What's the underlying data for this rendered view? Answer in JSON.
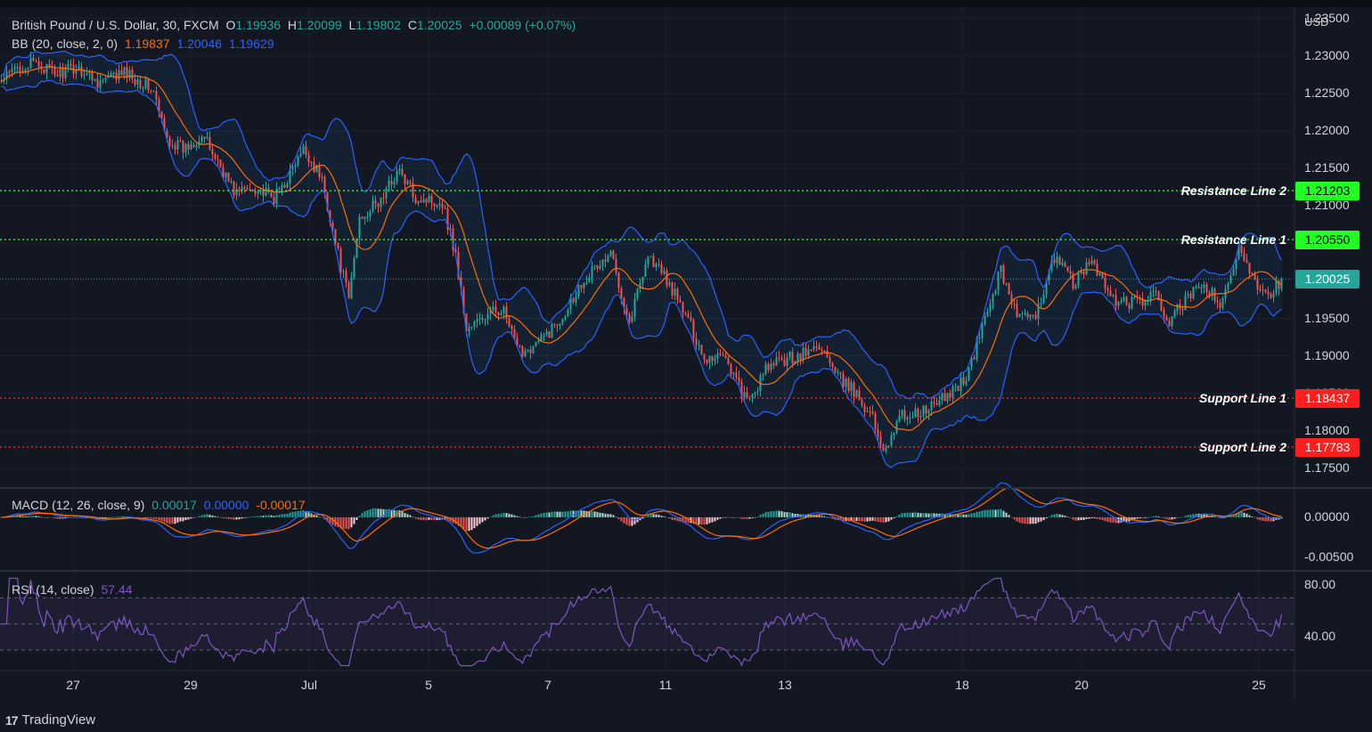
{
  "header": {
    "symbol": "British Pound / U.S. Dollar, 30, FXCM",
    "open_label": "O",
    "open": "1.19936",
    "high_label": "H",
    "high": "1.20099",
    "low_label": "L",
    "low": "1.19802",
    "close_label": "C",
    "close": "1.20025",
    "change": "+0.00089 (+0.07%)"
  },
  "bb": {
    "label": "BB (20, close, 2, 0)",
    "basis": "1.19837",
    "upper": "1.20046",
    "lower": "1.19629"
  },
  "macd": {
    "label": "MACD (12, 26, close, 9)",
    "hist": "0.00017",
    "macd": "0.00000",
    "signal": "-0.00017"
  },
  "rsi": {
    "label": "RSI (14, close)",
    "value": "57.44"
  },
  "axis": {
    "unit": "USD",
    "price_ticks": [
      "1.23500",
      "1.23000",
      "1.22500",
      "1.22000",
      "1.21500",
      "1.21000",
      "1.20500",
      "1.19500",
      "1.19000",
      "1.18500",
      "1.18000",
      "1.17500"
    ],
    "macd_ticks": [
      "0.00000",
      "-0.00500"
    ],
    "rsi_ticks": [
      "80.00",
      "40.00"
    ],
    "x_ticks": [
      "27",
      "29",
      "Jul",
      "5",
      "7",
      "11",
      "13",
      "18",
      "20",
      "25"
    ]
  },
  "lines": [
    {
      "name": "Resistance Line 2",
      "value": "1.21203",
      "color": "#22ff22",
      "badge_text_color": "#000000"
    },
    {
      "name": "Resistance Line 1",
      "value": "1.20550",
      "color": "#22ff22",
      "badge_text_color": "#000000"
    },
    {
      "name": "Support Line 1",
      "value": "1.18437",
      "color": "#ff1f1f",
      "badge_text_color": "#ffffff"
    },
    {
      "name": "Support Line 2",
      "value": "1.17783",
      "color": "#ff1f1f",
      "badge_text_color": "#ffffff"
    }
  ],
  "last_price": {
    "value": "1.20025",
    "color": "#26a69a"
  },
  "colors": {
    "up": "#26a69a",
    "down": "#ef5350",
    "bb_band": "#2962ff",
    "bb_basis": "#ff6d00",
    "macd_line": "#2962ff",
    "signal_line": "#ff6d00",
    "rsi_line": "#7e57c2"
  },
  "brand": "TradingView",
  "chart_data": {
    "type": "candlestick",
    "title": "British Pound / U.S. Dollar, 30, FXCM",
    "ylim": [
      1.1725,
      1.2365
    ],
    "dates": [
      "27",
      "29",
      "Jul",
      "5",
      "7",
      "11",
      "13",
      "18",
      "20",
      "25"
    ],
    "close_path": [
      [
        0,
        1.2265
      ],
      [
        18,
        1.2285
      ],
      [
        40,
        1.229
      ],
      [
        60,
        1.2275
      ],
      [
        85,
        1.2285
      ],
      [
        110,
        1.2265
      ],
      [
        140,
        1.2278
      ],
      [
        170,
        1.2255
      ],
      [
        185,
        1.219
      ],
      [
        205,
        1.2175
      ],
      [
        225,
        1.2195
      ],
      [
        245,
        1.2155
      ],
      [
        262,
        1.2118
      ],
      [
        285,
        1.2125
      ],
      [
        305,
        1.2108
      ],
      [
        320,
        1.2135
      ],
      [
        340,
        1.2175
      ],
      [
        360,
        1.2135
      ],
      [
        378,
        1.2035
      ],
      [
        390,
        1.1975
      ],
      [
        402,
        1.2085
      ],
      [
        425,
        1.2105
      ],
      [
        445,
        1.2148
      ],
      [
        465,
        1.2112
      ],
      [
        495,
        1.2105
      ],
      [
        510,
        1.2035
      ],
      [
        522,
        1.1935
      ],
      [
        540,
        1.195
      ],
      [
        562,
        1.1965
      ],
      [
        580,
        1.1905
      ],
      [
        600,
        1.1915
      ],
      [
        625,
        1.1945
      ],
      [
        655,
        1.2005
      ],
      [
        685,
        1.2035
      ],
      [
        705,
        1.1945
      ],
      [
        725,
        1.2035
      ],
      [
        745,
        1.2005
      ],
      [
        770,
        1.195
      ],
      [
        790,
        1.1895
      ],
      [
        810,
        1.1905
      ],
      [
        838,
        1.1835
      ],
      [
        860,
        1.1885
      ],
      [
        880,
        1.1895
      ],
      [
        905,
        1.1905
      ],
      [
        920,
        1.1915
      ],
      [
        935,
        1.1875
      ],
      [
        955,
        1.1855
      ],
      [
        975,
        1.1825
      ],
      [
        990,
        1.1775
      ],
      [
        1010,
        1.182
      ],
      [
        1035,
        1.1825
      ],
      [
        1060,
        1.1845
      ],
      [
        1085,
        1.1875
      ],
      [
        1105,
        1.1955
      ],
      [
        1122,
        1.2015
      ],
      [
        1140,
        1.1955
      ],
      [
        1160,
        1.1945
      ],
      [
        1180,
        1.2035
      ],
      [
        1205,
        1.1995
      ],
      [
        1225,
        1.203
      ],
      [
        1245,
        1.1975
      ],
      [
        1270,
        1.197
      ],
      [
        1295,
        1.198
      ],
      [
        1310,
        1.1945
      ],
      [
        1330,
        1.1975
      ],
      [
        1350,
        1.1995
      ],
      [
        1370,
        1.1965
      ],
      [
        1390,
        1.2045
      ],
      [
        1410,
        1.1995
      ],
      [
        1425,
        1.1985
      ],
      [
        1437,
        1.20025
      ]
    ],
    "levels": {
      "Resistance Line 2": 1.21203,
      "Resistance Line 1": 1.2055,
      "Support Line 1": 1.18437,
      "Support Line 2": 1.17783
    },
    "macd_ylim": [
      -0.0065,
      0.0035
    ],
    "rsi_ylim": [
      15,
      90
    ],
    "rsi_bands": [
      70,
      50,
      30
    ]
  }
}
